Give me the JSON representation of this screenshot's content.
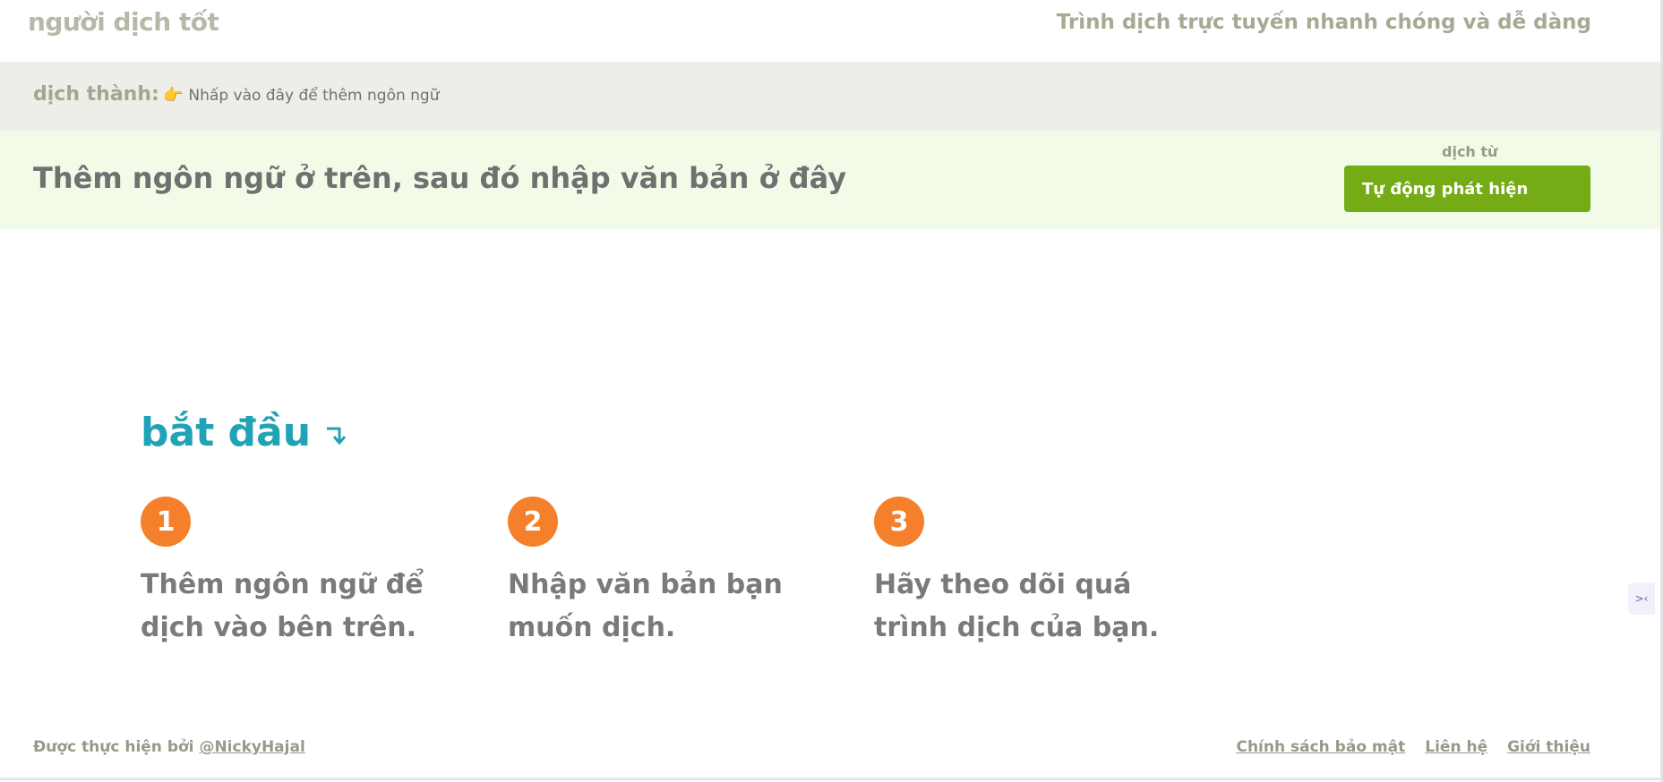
{
  "header": {
    "logo": "người dịch tốt",
    "tagline": "Trình dịch trực tuyến nhanh chóng và dễ dàng"
  },
  "language_bar": {
    "label": "dịch thành:",
    "add_language": "Nhấp vào đây để thêm ngôn ngữ"
  },
  "input": {
    "placeholder": "Thêm ngôn ngữ ở trên, sau đó nhập văn bản ở đây",
    "from_label": "dịch từ",
    "detect_button": "Tự động phát hiện"
  },
  "start": {
    "title": "bắt đầu",
    "steps": [
      {
        "number": "1",
        "text": "Thêm ngôn ngữ để dịch vào bên trên."
      },
      {
        "number": "2",
        "text": "Nhập văn bản bạn muốn dịch."
      },
      {
        "number": "3",
        "text": "Hãy theo dõi quá trình dịch của bạn."
      }
    ]
  },
  "footer": {
    "made_by_prefix": "Được thực hiện bởi",
    "author": "@NickyHajal",
    "links": [
      "Chính sách bảo mật",
      "Liên hệ",
      "Giới thiệu"
    ]
  },
  "colors": {
    "accent_green": "#75ab14",
    "title_teal": "#1fa3b5",
    "step_orange": "#f5802b",
    "input_bg": "#f2fbe8",
    "lang_bar_bg": "#eeeee8"
  },
  "icons": {
    "add_language": "pointing-hand-icon",
    "start": "arrow-down-right-icon",
    "side_widget": "widget-icon"
  }
}
